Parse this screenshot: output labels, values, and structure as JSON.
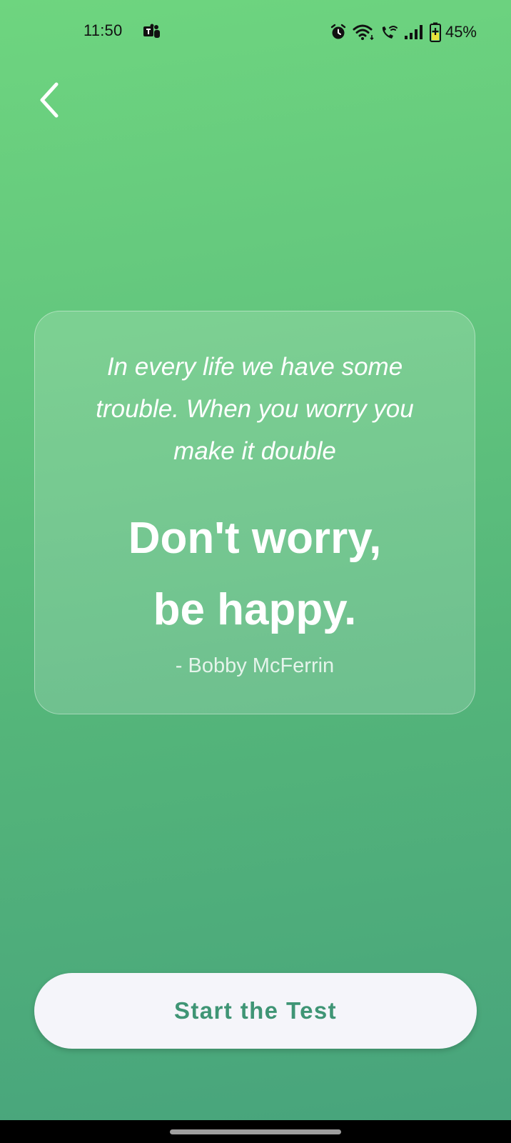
{
  "status_bar": {
    "time": "11:50",
    "battery": "45%",
    "icons": [
      "teams-icon",
      "alarm-icon",
      "wifi-icon",
      "wifi-calling-icon",
      "signal-icon",
      "battery-charging-icon"
    ]
  },
  "nav": {
    "back_icon": "chevron-left-icon"
  },
  "quote": {
    "text": "In every life we have some trouble. When you worry you make it double",
    "headline_line1": "Don't worry,",
    "headline_line2": "be happy.",
    "author": "- Bobby McFerrin"
  },
  "actions": {
    "start_label": "Start the Test"
  },
  "colors": {
    "background_top": "#6ed57f",
    "background_bottom": "#47a37c",
    "button_bg": "#f5f5fa",
    "button_text": "#3f9575"
  }
}
